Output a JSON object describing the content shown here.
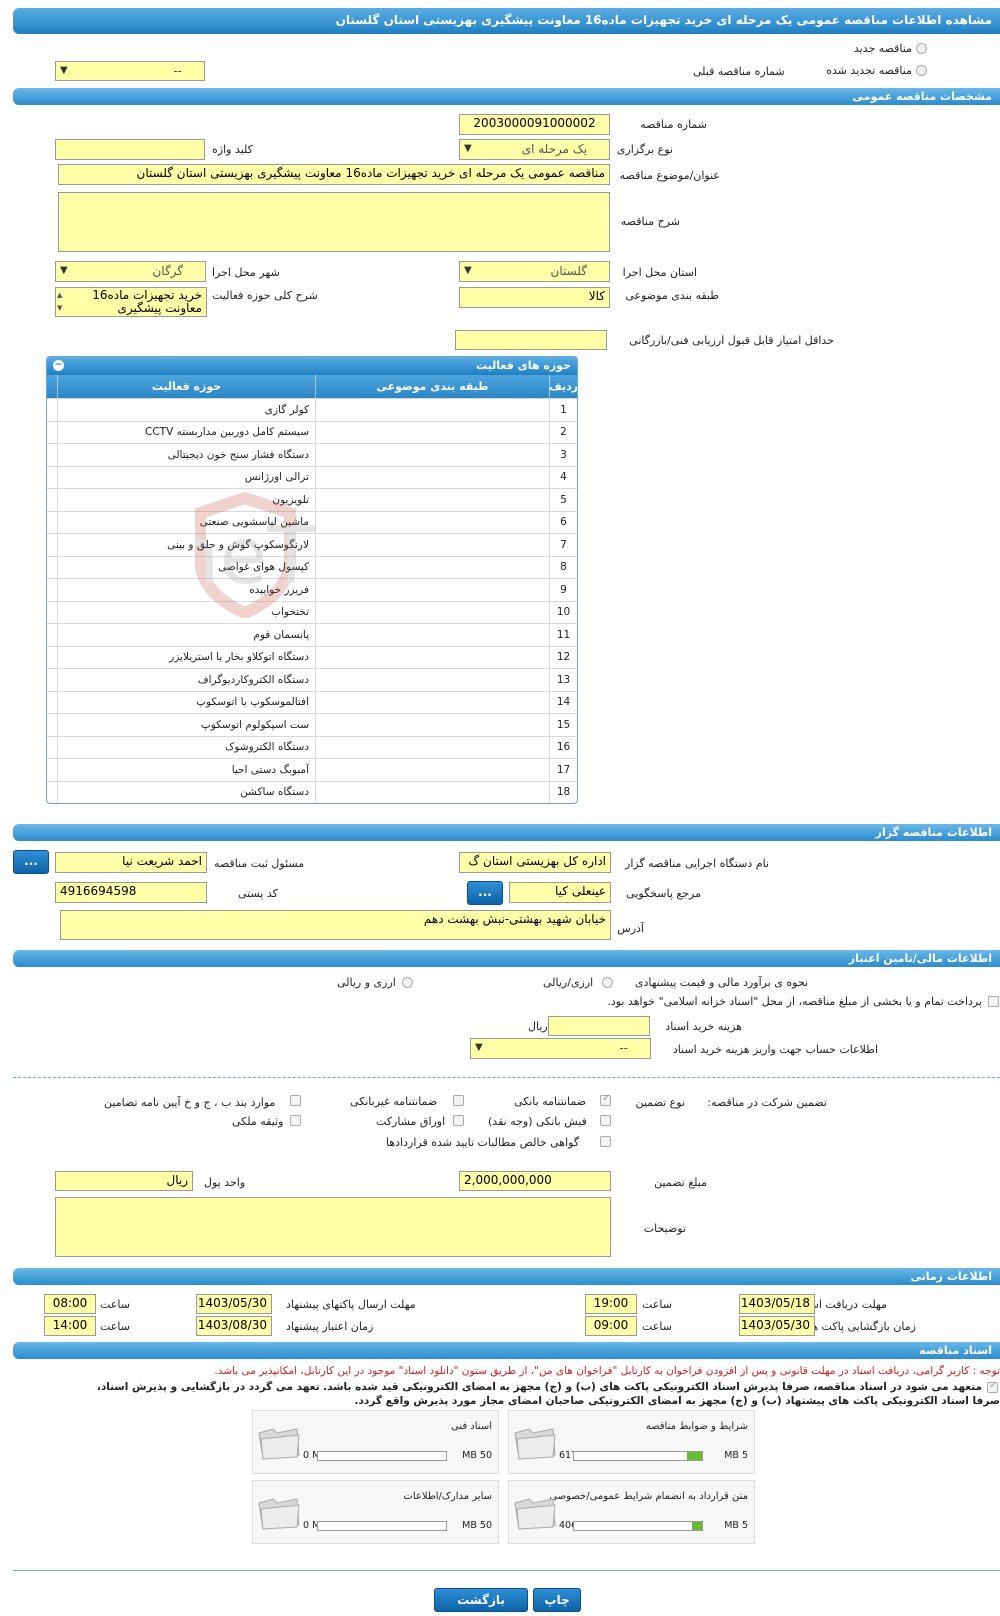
{
  "title": "مشاهده اطلاعات مناقصه عمومی یک مرحله ای خرید تجهیزات ماده16 معاونت پیشگیری بهزیستی استان گلستان",
  "top": {
    "new_tender": "مناقصه جدید",
    "renewed_tender": "مناقصه تجدید شده",
    "prev_tender_number_label": "شماره مناقصه قبلی",
    "prev_tender_number_value": "--"
  },
  "general": {
    "section_title": "مشخصات مناقصه عمومی",
    "tender_number_label": "شماره مناقصه",
    "tender_number": "2003000091000002",
    "holding_type_label": "نوع برگزاری",
    "holding_type": "یک مرحله ای",
    "keyword_label": "کلید واژه",
    "keyword": "",
    "subject_label": "عنوان/موضوع مناقصه",
    "subject": "مناقصه عمومی یک مرحله ای خرید تجهیزات ماده16 معاونت پیشگیری بهزیستی استان گلستان",
    "description_label": "شرح مناقصه",
    "description": "",
    "province_label": "استان محل اجرا",
    "province": "گلستان",
    "city_label": "شهر محل اجرا",
    "city": "گرگان",
    "category_label": "طبقه بندی موضوعی",
    "category": "کالا",
    "activity_desc_label": "شرح کلی حوزه فعالیت",
    "activity_desc": "خرید تجهیزات ماده16 معاونت پیشگیری",
    "min_score_label": "حداقل امتیاز قابل قبول ارزیابی فنی/بازرگانی",
    "min_score": ""
  },
  "activities": {
    "title": "حوزه های فعالیت",
    "columns": [
      "ردیف",
      "طبقه بندی موضوعی",
      "حوزه فعالیت"
    ],
    "rows": [
      {
        "n": "1",
        "cat": "",
        "field": "کولر گازی"
      },
      {
        "n": "2",
        "cat": "",
        "field": "سیستم کامل دوربین مداربسته CCTV"
      },
      {
        "n": "3",
        "cat": "",
        "field": "دستگاه فشار سنج خون دیجیتالی"
      },
      {
        "n": "4",
        "cat": "",
        "field": "ترالی اورژانس"
      },
      {
        "n": "5",
        "cat": "",
        "field": "تلویزیون"
      },
      {
        "n": "6",
        "cat": "",
        "field": "ماشین لباسشویی صنعتی"
      },
      {
        "n": "7",
        "cat": "",
        "field": "لارنگوسکوپ گوش و حلق و بینی"
      },
      {
        "n": "8",
        "cat": "",
        "field": "کپسول هوای غواصی"
      },
      {
        "n": "9",
        "cat": "",
        "field": "فریزر خوابیده"
      },
      {
        "n": "10",
        "cat": "",
        "field": "تختخواب"
      },
      {
        "n": "11",
        "cat": "",
        "field": "پانسمان فوم"
      },
      {
        "n": "12",
        "cat": "",
        "field": "دستگاه اتوکلاو بخار یا استریلایزر"
      },
      {
        "n": "13",
        "cat": "",
        "field": "دستگاه الکتروکاردیوگراف"
      },
      {
        "n": "14",
        "cat": "",
        "field": "افتالموسکوپ یا اتوسکوپ"
      },
      {
        "n": "15",
        "cat": "",
        "field": "ست اسپکولوم اتوسکوپ"
      },
      {
        "n": "16",
        "cat": "",
        "field": "دستگاه الکتروشوک"
      },
      {
        "n": "17",
        "cat": "",
        "field": "آمبوبگ دستی احیا"
      },
      {
        "n": "18",
        "cat": "",
        "field": "دستگاه ساکشن"
      }
    ]
  },
  "organizer": {
    "section_title": "اطلاعات مناقصه گزار",
    "org_label": "نام دستگاه اجرایی مناقصه گزار",
    "org": "اداره کل بهزیستی استان گ",
    "registrar_label": "مسئول ثبت مناقصه",
    "registrar": "احمد شریعت نیا",
    "responder_label": "مرجع پاسخگویی",
    "responder": "عینعلی کیا",
    "postal_label": "کد پستی",
    "postal": "4916694598",
    "address_label": "آدرس",
    "address": "خیابان شهید بهشتی-نبش بهشت دهم",
    "more_btn": "..."
  },
  "finance": {
    "section_title": "اطلاعات مالی/تامین اعتبار",
    "estimate_label": "نحوه ی برآورد مالی و قیمت پیشنهادی",
    "opt_rial": "ارزی/ریالی",
    "opt_currency_rial": "ارزی و ریالی",
    "treasury_text": "پرداخت تمام و یا بخشی از مبلغ مناقصه، از محل \"اسناد خزانه اسلامی\" خواهد بود.",
    "doc_cost_label": "هزینه خرید اسناد",
    "doc_cost": "",
    "doc_cost_unit": "ریال",
    "account_label": "اطلاعات حساب جهت واریز هزینه خرید اسناد",
    "account": "--",
    "guarantee_label": "تضمین شرکت در مناقصه:",
    "guarantee_type_label": "نوع تضمین",
    "g_bank": "ضمانتنامه بانکی",
    "g_nonbank": "ضمانتنامه غیربانکی",
    "g_clauses": "موارد بند ب ، ج و خ آیین نامه تضامین",
    "g_check": "فیش بانکی (وجه نقد)",
    "g_bonds": "اوراق مشارکت",
    "g_property": "وثیقه ملکی",
    "g_claims": "گواهی خالص مطالبات تایید شده قراردادها",
    "amount_label": "مبلغ تضمین",
    "amount": "2,000,000,000",
    "unit_label": "واحد پول",
    "unit": "ریال",
    "notes_label": "توضیحات",
    "notes": ""
  },
  "timing": {
    "section_title": "اطلاعات زمانی",
    "doc_deadline_label": "مهلت دریافت اسناد",
    "doc_deadline_date": "1403/05/18",
    "doc_deadline_time": "19:00",
    "send_deadline_label": "مهلت ارسال پاکتهای پیشنهاد",
    "send_deadline_date": "1403/05/30",
    "send_deadline_time": "08:00",
    "opening_label": "زمان بازگشایی پاکت ها",
    "opening_date": "1403/05/30",
    "opening_time": "09:00",
    "validity_label": "زمان اعتبار پیشنهاد",
    "validity_date": "1403/08/30",
    "validity_time": "14:00",
    "time_label": "ساعت"
  },
  "documents": {
    "section_title": "اسناد مناقصه",
    "notice": "توجه : کاربر گرامی، دریافت اسناد در مهلت قانونی و پس از افزودن فراخوان به کارتابل \"فراخوان های من\"، از طریق ستون \"دانلود اسناد\" موجود در این کارتابل، امکانپذیر می باشد.",
    "commit1": "متعهد می شود در اسناد مناقصه، صرفاً پذیرش اسناد الکترونیکی پاکت های (ب) و (ج) مجهز به امضای الکترونیکی قید شده باشد. تعهد می گردد در بازگشایی و پذیرش اسناد،",
    "commit2": "صرفاً اسناد الکترونیکی پاکت های پیشنهاد (ب) و (ج) مجهز به امضای الکترونیکی صاحبان امضای مجاز مورد پذیرش واقع گردد.",
    "files": [
      {
        "title": "شرایط و ضوابط مناقصه",
        "max": "5 MB",
        "cur": "617 KB",
        "fill": 0.12
      },
      {
        "title": "اسناد فنی",
        "max": "50 MB",
        "cur": "0 MB",
        "fill": 0
      },
      {
        "title": "متن قرارداد به انضمام شرایط عمومی/خصوصی",
        "max": "5 MB",
        "cur": "406 KB",
        "fill": 0.08
      },
      {
        "title": "سایر مدارک/اطلاعات",
        "max": "50 MB",
        "cur": "0 MB",
        "fill": 0
      }
    ]
  },
  "buttons": {
    "print": "چاپ",
    "back": "بازگشت"
  },
  "watermark": "AriaTender.neT"
}
